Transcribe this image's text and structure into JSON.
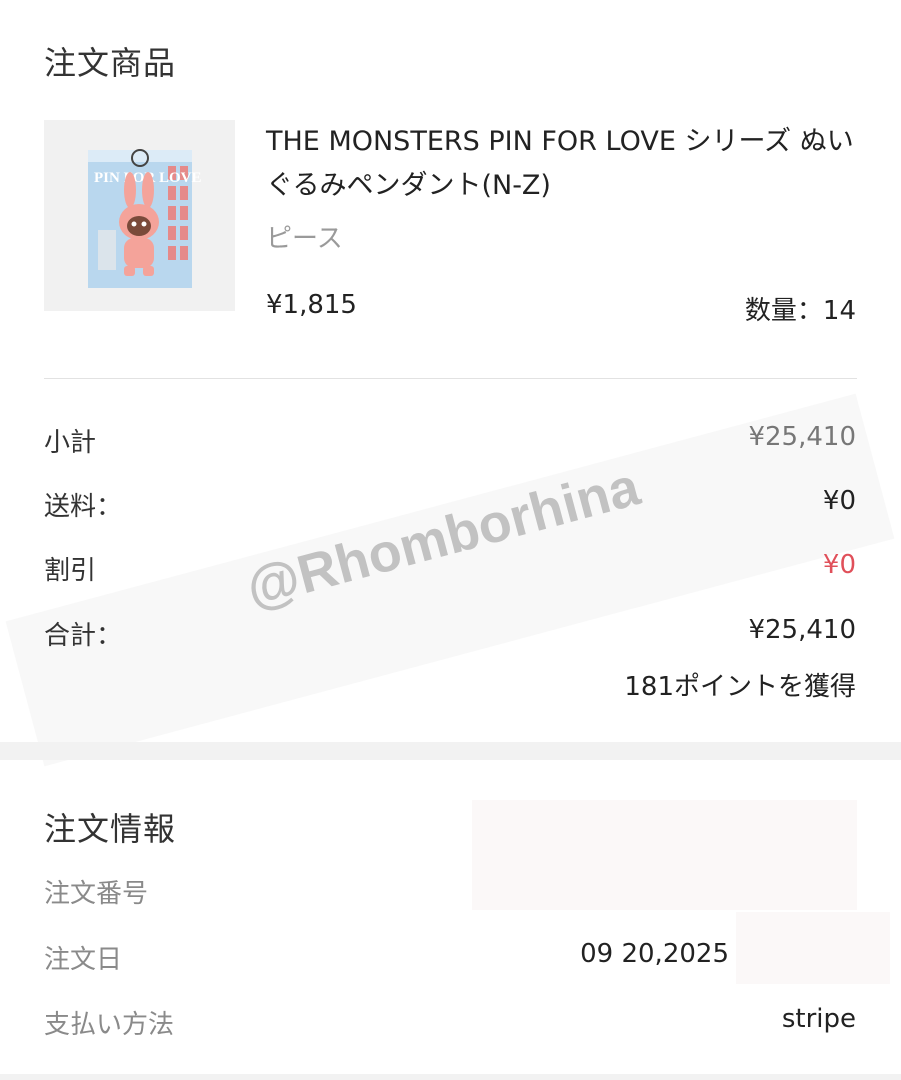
{
  "order_items": {
    "title": "注文商品",
    "product": {
      "name": "THE MONSTERS PIN FOR LOVE シリーズ ぬいぐるみペンダント(N-Z)",
      "variant": "ピース",
      "price": "¥1,815",
      "quantity_label": "数量：14",
      "box_text": "PIN FOR LOVE"
    }
  },
  "summary": {
    "subtotal_label": "小計",
    "subtotal_value": "¥25,410",
    "shipping_label": "送料：",
    "shipping_value": "¥0",
    "discount_label": "割引",
    "discount_value": "¥0",
    "total_label": "合計：",
    "total_value": "¥25,410",
    "points_text": "181ポイントを獲得"
  },
  "order_info": {
    "title": "注文情報",
    "order_number_label": "注文番号",
    "order_date_label": "注文日",
    "order_date_value": "09 20,2025",
    "payment_method_label": "支払い方法",
    "payment_method_value": "stripe"
  },
  "watermark": "@Rhomborhina",
  "colors": {
    "discount": "#e0505a",
    "muted": "#8a8a8a",
    "band": "#f2f2f2"
  }
}
